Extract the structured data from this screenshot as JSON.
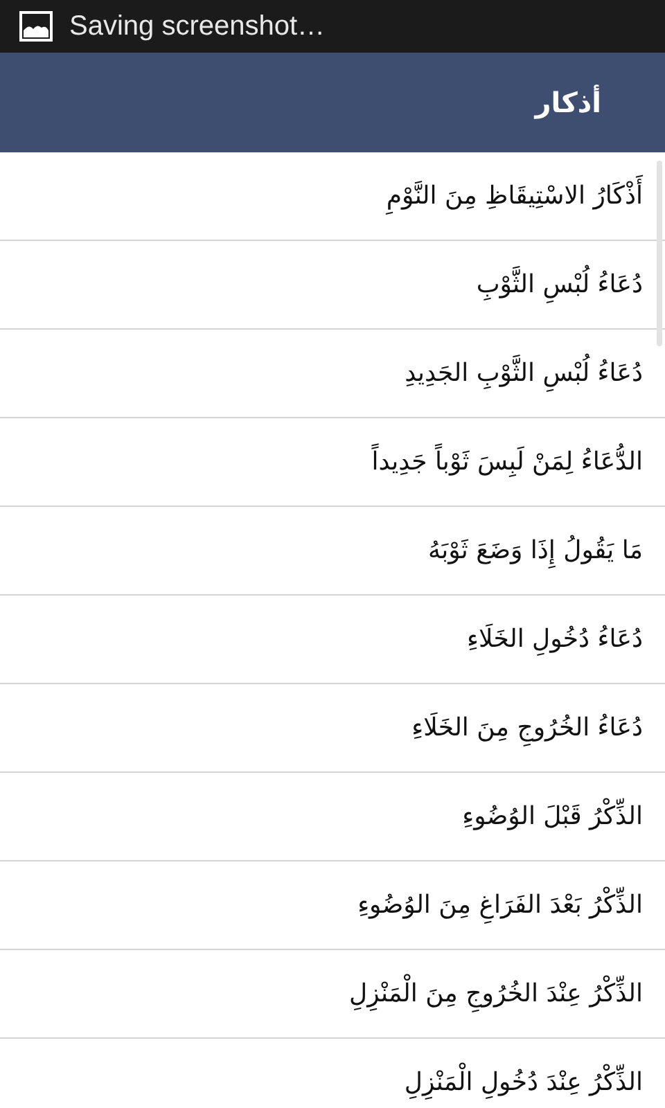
{
  "status_bar": {
    "notification": "Saving screenshot…"
  },
  "action_bar": {
    "title": "أذكار"
  },
  "items": [
    {
      "label": "أَذْكَارُ الاسْتِيقَاظِ مِنَ النَّوْمِ"
    },
    {
      "label": "دُعَاءُ لُبْسِ الثَّوْبِ"
    },
    {
      "label": "دُعَاءُ لُبْسِ الثَّوْبِ الجَدِيدِ"
    },
    {
      "label": "الدُّعَاءُ لِمَنْ لَبِسَ ثَوْباً جَدِيداً"
    },
    {
      "label": "مَا يَقُولُ إِذَا وَضَعَ ثَوْبَهُ"
    },
    {
      "label": "دُعَاءُ دُخُولِ الخَلَاءِ"
    },
    {
      "label": "دُعَاءُ الخُرُوجِ مِنَ الخَلَاءِ"
    },
    {
      "label": "الذِّكْرُ قَبْلَ الوُضُوءِ"
    },
    {
      "label": "الذِّكْرُ بَعْدَ الفَرَاغِ مِنَ الوُضُوءِ"
    },
    {
      "label": "الذِّكْرُ عِنْدَ الخُرُوجِ مِنَ الْمَنْزِلِ"
    },
    {
      "label": "الذِّكْرُ عِنْدَ دُخُولِ الْمَنْزِلِ"
    }
  ]
}
